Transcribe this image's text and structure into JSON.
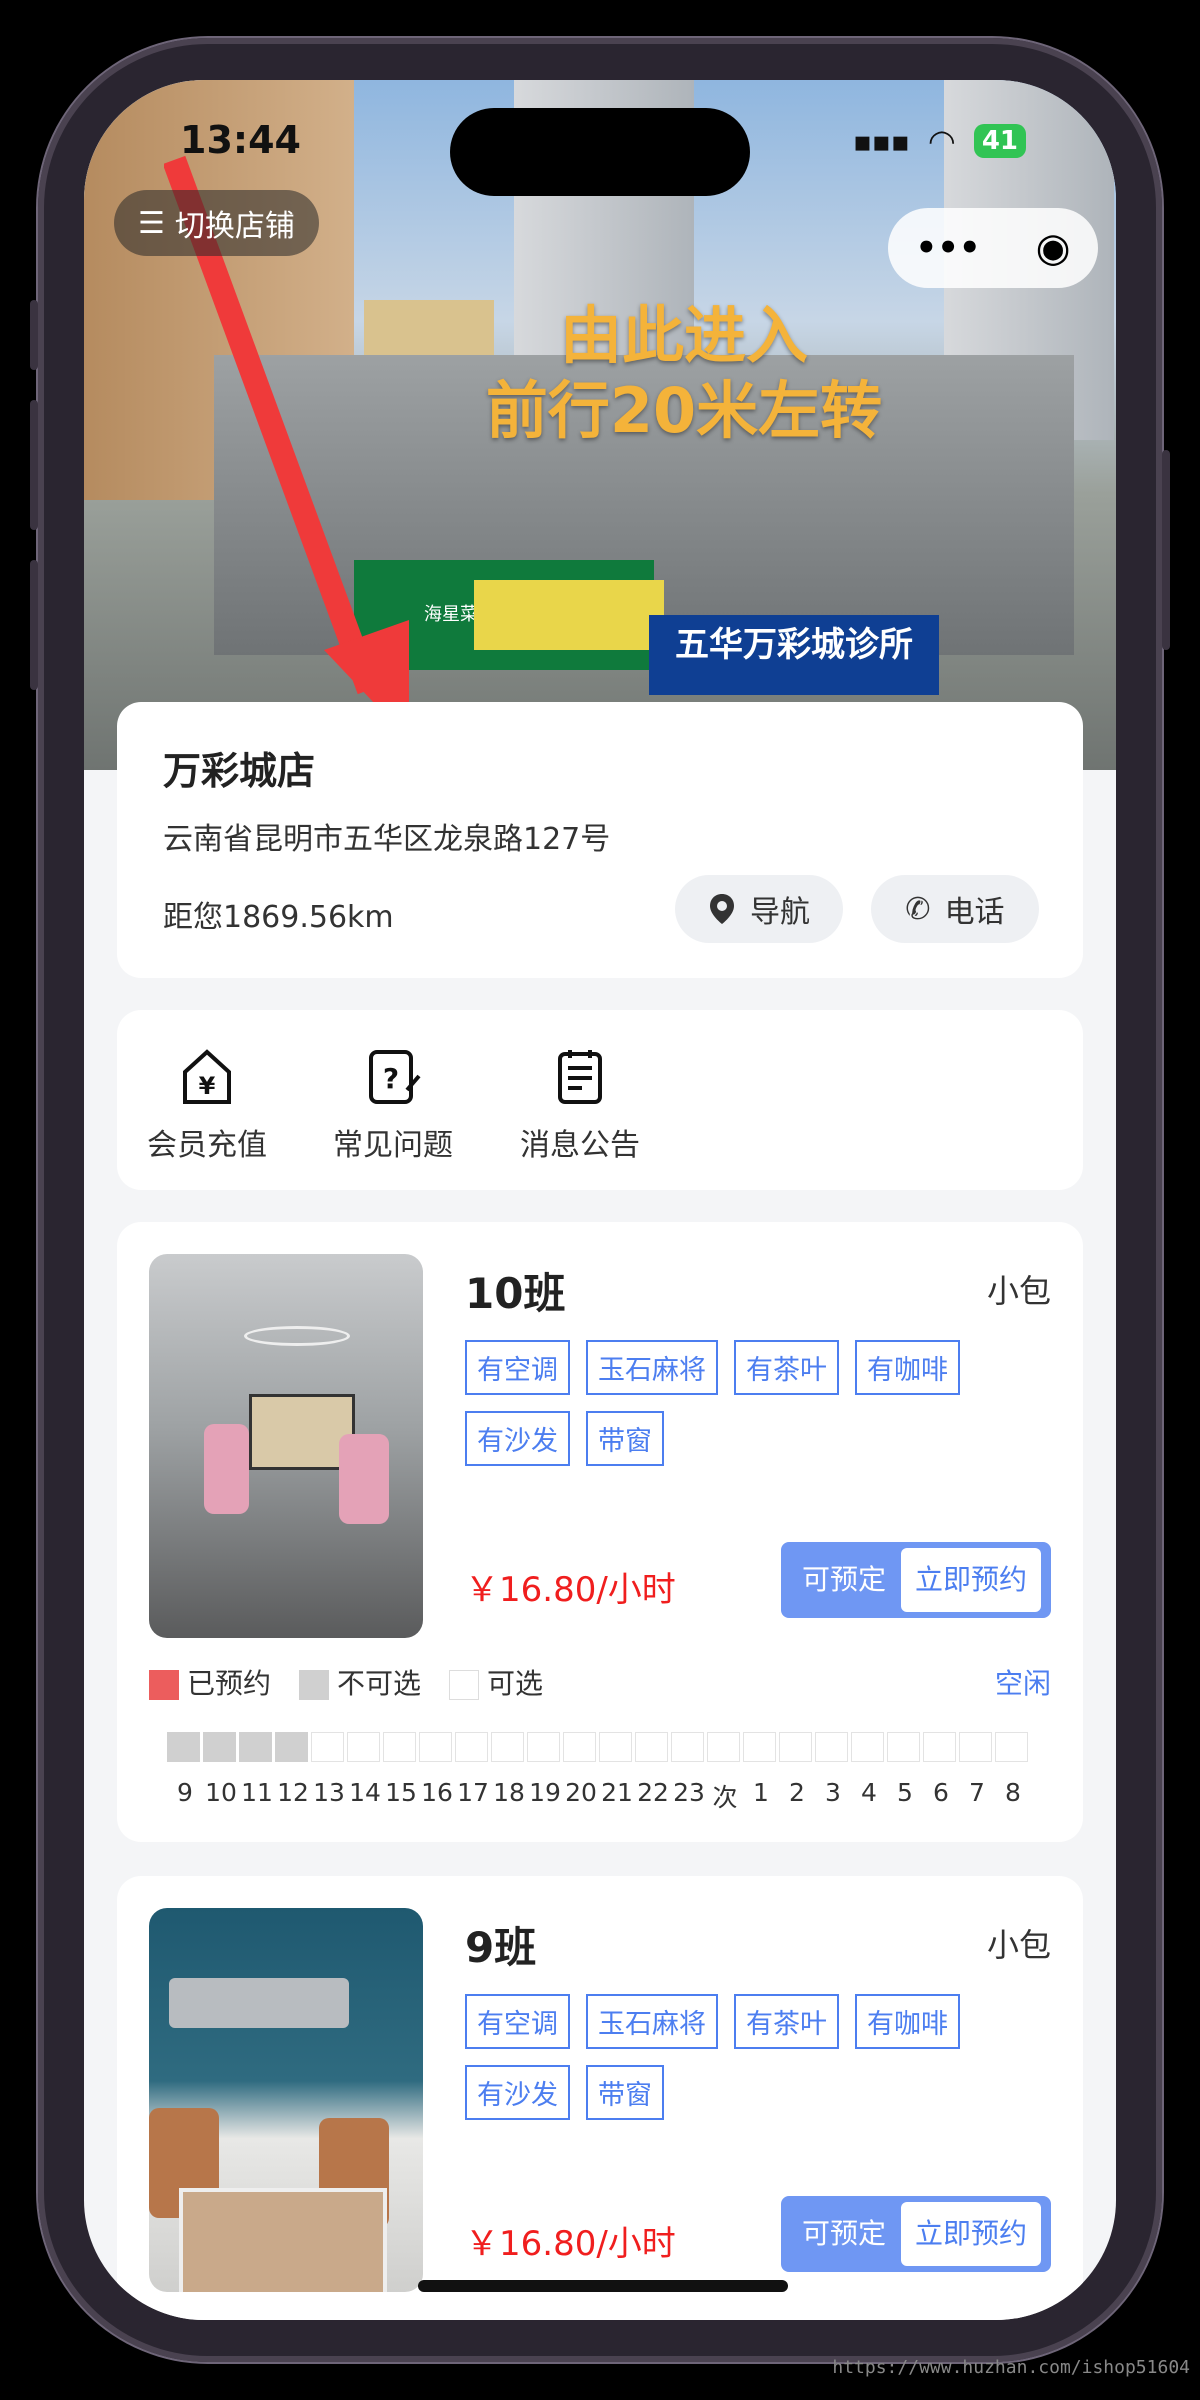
{
  "status": {
    "time": "13:44",
    "battery": "41"
  },
  "hero": {
    "switch_store": "切换店铺",
    "line1": "由此进入",
    "line2": "前行20米左转",
    "sign_clinic": "五华万彩城诊所",
    "sign_market": "海星菜市"
  },
  "store": {
    "name": "万彩城店",
    "address": "云南省昆明市五华区龙泉路127号",
    "distance": "距您1869.56km",
    "nav_label": "导航",
    "phone_label": "电话"
  },
  "quick": [
    {
      "label": "会员充值",
      "icon": "member-recharge-icon"
    },
    {
      "label": "常见问题",
      "icon": "faq-icon"
    },
    {
      "label": "消息公告",
      "icon": "notice-icon"
    }
  ],
  "rooms": [
    {
      "title": "10班",
      "type": "小包",
      "tags": [
        "有空调",
        "玉石麻将",
        "有茶叶",
        "有咖啡",
        "有沙发",
        "带窗"
      ],
      "price": "￥16.80/小时",
      "avail_label": "可预定",
      "book_label": "立即预约",
      "legend": {
        "booked": "已预约",
        "unavailable": "不可选",
        "selectable": "可选"
      },
      "status": "空闲",
      "hours": [
        "9",
        "10",
        "11",
        "12",
        "13",
        "14",
        "15",
        "16",
        "17",
        "18",
        "19",
        "20",
        "21",
        "22",
        "23",
        "次",
        "1",
        "2",
        "3",
        "4",
        "5",
        "6",
        "7",
        "8"
      ],
      "slot_states": [
        "gray",
        "gray",
        "gray",
        "gray",
        "open",
        "open",
        "open",
        "open",
        "open",
        "open",
        "open",
        "open",
        "open",
        "open",
        "open",
        "open",
        "open",
        "open",
        "open",
        "open",
        "open",
        "open",
        "open",
        "open"
      ]
    },
    {
      "title": "9班",
      "type": "小包",
      "tags": [
        "有空调",
        "玉石麻将",
        "有茶叶",
        "有咖啡",
        "有沙发",
        "带窗"
      ],
      "price": "￥16.80/小时",
      "avail_label": "可预定",
      "book_label": "立即预约"
    }
  ],
  "colors": {
    "accent": "#4c7ef0",
    "price": "#f01e1e",
    "booked": "#ec5d5d",
    "unavailable": "#d0d0d0",
    "button": "#6f97f3"
  },
  "watermark": "https://www.huzhan.com/ishop51604"
}
